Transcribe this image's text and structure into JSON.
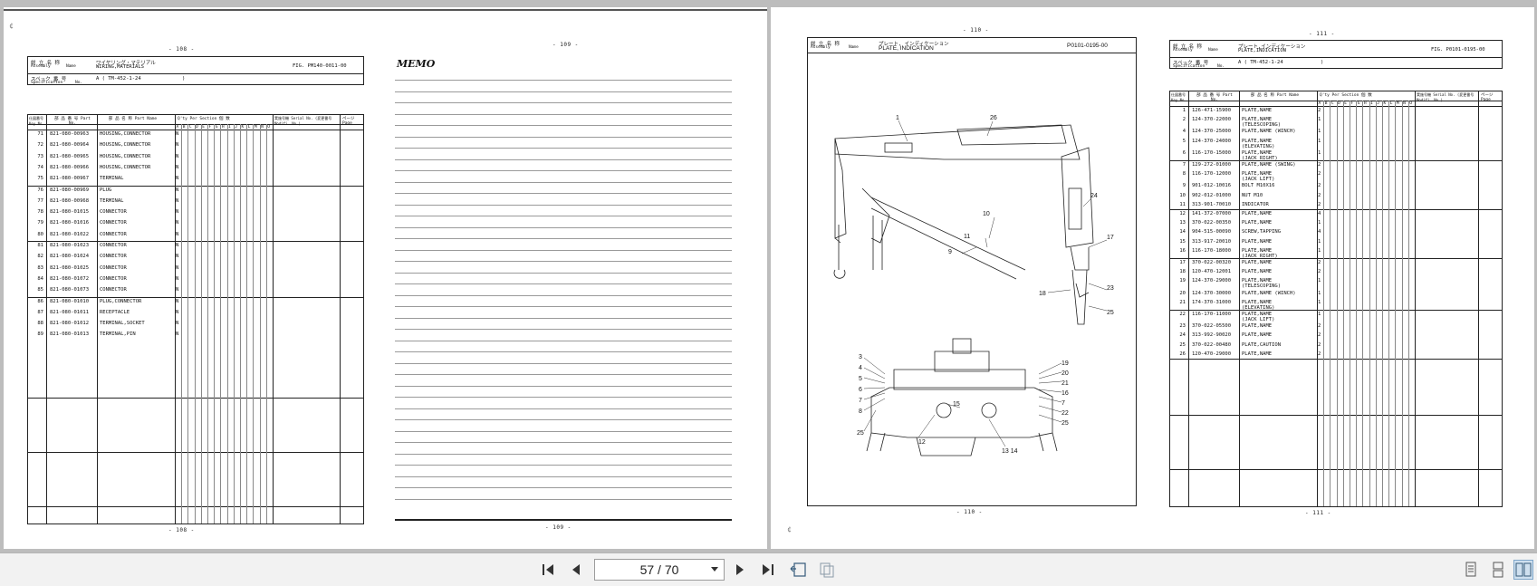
{
  "viewer": {
    "current_page": "57 / 70",
    "controls": {
      "first_page": "first-page",
      "prev_page": "prev-page",
      "next_page": "next-page",
      "last_page": "last-page",
      "view_mode_single": "single-page-view",
      "view_mode_continuous": "continuous-view",
      "view_mode_spread": "two-page-view"
    }
  },
  "page108": {
    "page_number_top": "- 108 -",
    "page_number_bottom": "- 108 -",
    "assembly_jp": "総 立 名 称",
    "assembly_en": "Assembly",
    "name_en": "Name",
    "name_jp": "ワイヤリング・マテリアル",
    "name_value": "WIRING,MATERIALS",
    "fig": "FIG.  PM140-0011-00",
    "spec_jp": "スペック 番 号",
    "spec_en": "Specification",
    "spec_no": "No.",
    "spec_value": "A ( TM-452-1-24",
    "spec_arrow": ")",
    "col_key": "仕図番号 Key No.",
    "col_part_no": "部 品 番 号 Part No.",
    "col_part_name": "部 品 名 称 Part Name",
    "col_qty": "Q'ty Per Section 個 数",
    "col_serial": "実施号機 Serial No. (変更番号 Modifi. No.)",
    "col_page": "ページ Page",
    "letters": [
      "A",
      "B",
      "C",
      "D",
      "E",
      "F",
      "G",
      "H",
      "I",
      "J",
      "K",
      "L",
      "M",
      "N",
      "O"
    ],
    "rows": [
      {
        "key": "71",
        "part": "821-080-00963",
        "name": "HOUSING,CONNECTOR",
        "qty": "N"
      },
      {
        "key": "72",
        "part": "821-080-00964",
        "name": "HOUSING,CONNECTOR",
        "qty": "N"
      },
      {
        "key": "73",
        "part": "821-080-00965",
        "name": "HOUSING,CONNECTOR",
        "qty": "N"
      },
      {
        "key": "74",
        "part": "821-080-00966",
        "name": "HOUSING,CONNECTOR",
        "qty": "N"
      },
      {
        "key": "75",
        "part": "821-080-00967",
        "name": "TERMINAL",
        "qty": "N"
      },
      {
        "key": "76",
        "part": "821-080-00969",
        "name": "PLUG",
        "qty": "N"
      },
      {
        "key": "77",
        "part": "821-080-00968",
        "name": "TERMINAL",
        "qty": "N"
      },
      {
        "key": "78",
        "part": "821-080-01015",
        "name": "CONNECTOR",
        "qty": "N"
      },
      {
        "key": "79",
        "part": "821-080-01016",
        "name": "CONNECTOR",
        "qty": "N"
      },
      {
        "key": "80",
        "part": "821-080-01022",
        "name": "CONNECTOR",
        "qty": "N"
      },
      {
        "key": "81",
        "part": "821-080-01023",
        "name": "CONNECTOR",
        "qty": "N"
      },
      {
        "key": "82",
        "part": "821-080-01024",
        "name": "CONNECTOR",
        "qty": "N"
      },
      {
        "key": "83",
        "part": "821-080-01025",
        "name": "CONNECTOR",
        "qty": "N"
      },
      {
        "key": "84",
        "part": "821-080-01072",
        "name": "CONNECTOR",
        "qty": "N"
      },
      {
        "key": "85",
        "part": "821-080-01073",
        "name": "CONNECTOR",
        "qty": "N"
      },
      {
        "key": "86",
        "part": "821-080-01010",
        "name": "PLUG,CONNECTOR",
        "qty": "N"
      },
      {
        "key": "87",
        "part": "821-080-01011",
        "name": "RECEPTACLE",
        "qty": "N"
      },
      {
        "key": "88",
        "part": "821-080-01012",
        "name": "TERMINAL,SOCKET",
        "qty": "N"
      },
      {
        "key": "89",
        "part": "821-080-01013",
        "name": "TERMINAL,PIN",
        "qty": "N"
      }
    ]
  },
  "page109": {
    "page_number_top": "- 109 -",
    "page_number_bottom": "- 109 -",
    "memo_title": "MEMO"
  },
  "page110": {
    "page_number_top": "- 110 -",
    "page_number_bottom": "- 110 -",
    "assembly_jp": "総 立 名 称",
    "assembly_en": "Assembly",
    "name_en": "Name",
    "name_jp": "プレート, インディケーション",
    "name_value": "PLATE, INDICATION",
    "fig_no": "P0101-0195-00",
    "callouts": [
      "1",
      "26",
      "24",
      "10",
      "17",
      "11",
      "9",
      "18",
      "23",
      "25",
      "3",
      "4",
      "5",
      "6",
      "7",
      "8",
      "25",
      "19",
      "20",
      "21",
      "16",
      "7",
      "22",
      "25",
      "15",
      "12",
      "13",
      "14"
    ]
  },
  "page111": {
    "page_number_top": "- 111 -",
    "page_number_bottom": "- 111 -",
    "assembly_jp": "総 立 名 称",
    "assembly_en": "Assembly",
    "name_en": "Name",
    "name_jp": "プレート,インディケーション",
    "name_value": "PLATE,INDICATION",
    "fig": "FIG.  P0101-0195-00",
    "spec_jp": "スペック 番 号",
    "spec_en": "Specification",
    "spec_no": "No.",
    "spec_value": "A ( TM-452-1-24",
    "spec_arrow": ")",
    "col_key": "仕図番号 Key No.",
    "col_part_no": "部 品 番 号 Part No.",
    "col_part_name": "部 品 名 称 Part Name",
    "col_qty": "Q'ty Per Section 個 数",
    "col_serial": "実施号機 Serial No. (変更番号 Modifi. No.)",
    "col_page": "ページ Page",
    "letters": [
      "A",
      "B",
      "C",
      "D",
      "E",
      "F",
      "G",
      "H",
      "I",
      "J",
      "K",
      "L",
      "M",
      "N",
      "O"
    ],
    "rows": [
      {
        "key": "1",
        "part": "126-471-15900",
        "name": "PLATE,NAME",
        "qty": "2"
      },
      {
        "key": "2",
        "part": "124-370-22000",
        "name": "PLATE,NAME",
        "name2": "(TELESCOPING)",
        "qty": "1"
      },
      {
        "key": "4",
        "part": "124-370-25000",
        "name": "PLATE,NAME (WINCH)",
        "qty": "1"
      },
      {
        "key": "5",
        "part": "124-370-24000",
        "name": "PLATE,NAME",
        "name2": "(ELEVATING)",
        "qty": "1"
      },
      {
        "key": "6",
        "part": "116-170-15000",
        "name": "PLATE,NAME",
        "name2": "(JACK RIGHT)",
        "qty": "1"
      },
      {
        "key": "7",
        "part": "129-272-01000",
        "name": "PLATE,NAME (SWING)",
        "qty": "2"
      },
      {
        "key": "8",
        "part": "116-170-12000",
        "name": "PLATE,NAME",
        "name2": "(JACK LIFT)",
        "qty": "2"
      },
      {
        "key": "9",
        "part": "901-012-10016",
        "name": "BOLT M10X16",
        "qty": "2"
      },
      {
        "key": "10",
        "part": "902-012-01000",
        "name": "NUT M10",
        "qty": "2"
      },
      {
        "key": "11",
        "part": "313-901-70010",
        "name": "INDICATOR",
        "qty": "2"
      },
      {
        "key": "12",
        "part": "141-372-07000",
        "name": "PLATE,NAME",
        "qty": "4"
      },
      {
        "key": "13",
        "part": "370-022-00350",
        "name": "PLATE,NAME",
        "qty": "1"
      },
      {
        "key": "14",
        "part": "904-515-00090",
        "name": "SCREW,TAPPING",
        "qty": "4"
      },
      {
        "key": "15",
        "part": "313-917-20010",
        "name": "PLATE,NAME",
        "qty": "1"
      },
      {
        "key": "16",
        "part": "116-170-18000",
        "name": "PLATE,NAME",
        "name2": "(JACK RIGHT)",
        "qty": "1"
      },
      {
        "key": "17",
        "part": "370-022-00320",
        "name": "PLATE,NAME",
        "qty": "2"
      },
      {
        "key": "18",
        "part": "120-470-12001",
        "name": "PLATE,NAME",
        "qty": "2"
      },
      {
        "key": "19",
        "part": "124-370-29000",
        "name": "PLATE,NAME",
        "name2": "(TELESCOPING)",
        "qty": "1"
      },
      {
        "key": "20",
        "part": "124-370-30000",
        "name": "PLATE,NAME (WINCH)",
        "qty": "1"
      },
      {
        "key": "21",
        "part": "174-370-31000",
        "name": "PLATE,NAME",
        "name2": "(ELEVATING)",
        "qty": "1"
      },
      {
        "key": "22",
        "part": "116-170-11000",
        "name": "PLATE,NAME",
        "name2": "(JACK LIFT)",
        "qty": "1"
      },
      {
        "key": "23",
        "part": "370-022-05500",
        "name": "PLATE,NAME",
        "qty": "2"
      },
      {
        "key": "24",
        "part": "313-992-90020",
        "name": "PLATE,NAME",
        "qty": "2"
      },
      {
        "key": "25",
        "part": "370-022-00480",
        "name": "PLATE,CAUTION",
        "qty": "2"
      },
      {
        "key": "26",
        "part": "120-470-29000",
        "name": "PLATE,NAME",
        "qty": "2"
      }
    ]
  }
}
